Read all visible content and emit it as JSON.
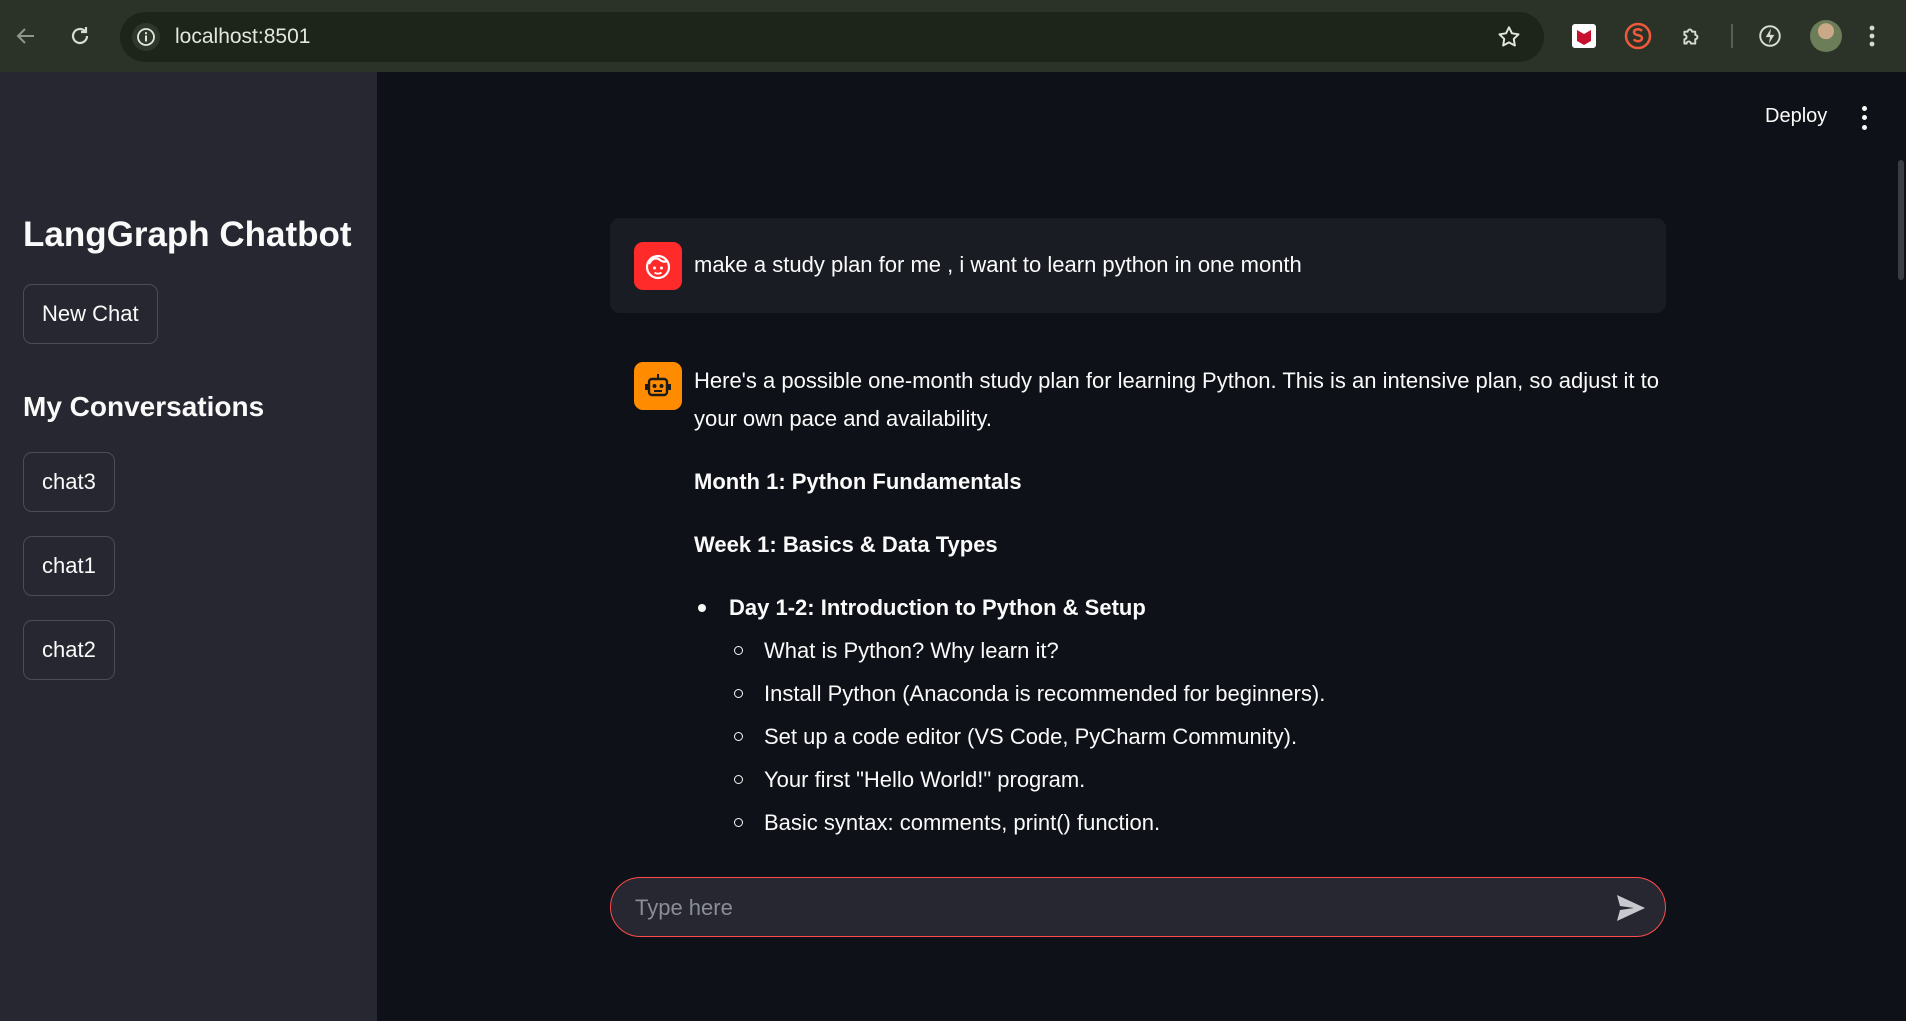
{
  "browser": {
    "url": "localhost:8501"
  },
  "sidebar": {
    "title": "LangGraph Chatbot",
    "new_chat_label": "New Chat",
    "conversations_heading": "My Conversations",
    "conversations": [
      "chat3",
      "chat1",
      "chat2"
    ]
  },
  "header": {
    "deploy_label": "Deploy"
  },
  "messages": {
    "user": {
      "text": "make a study plan for me , i want to learn python in one month"
    },
    "assistant": {
      "intro": "Here's a possible one-month study plan for learning Python. This is an intensive plan, so adjust it to your own pace and availability.",
      "month_heading": "Month 1: Python Fundamentals",
      "week_heading": "Week 1: Basics & Data Types",
      "day_heading": "Day 1-2: Introduction to Python & Setup",
      "day_items": [
        "What is Python? Why learn it?",
        "Install Python (Anaconda is recommended for beginners).",
        "Set up a code editor (VS Code, PyCharm Community).",
        "Your first \"Hello World!\" program.",
        "Basic syntax: comments, print() function."
      ]
    }
  },
  "chat_input": {
    "placeholder": "Type here",
    "border_color": "#ff4b4b"
  },
  "colors": {
    "user_avatar": "#ff2b2b",
    "assistant_avatar": "#ff8c00",
    "sidebar_bg": "#262730",
    "main_bg": "#0e1117"
  }
}
